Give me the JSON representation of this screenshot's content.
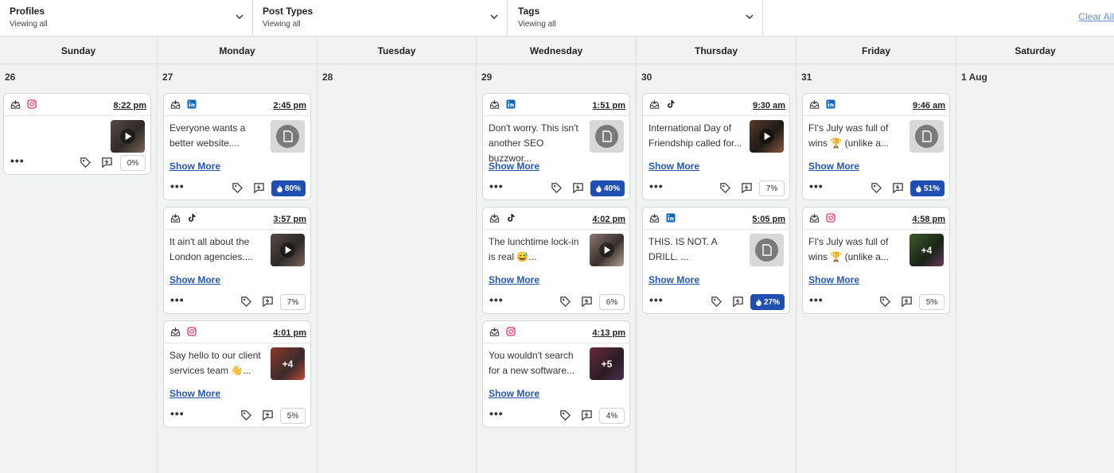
{
  "filters": [
    {
      "title": "Profiles",
      "subtitle": "Viewing all"
    },
    {
      "title": "Post Types",
      "subtitle": "Viewing all"
    },
    {
      "title": "Tags",
      "subtitle": "Viewing all"
    }
  ],
  "clear_all_label": "Clear All",
  "days": [
    {
      "name": "Sunday",
      "date": "26"
    },
    {
      "name": "Monday",
      "date": "27"
    },
    {
      "name": "Tuesday",
      "date": "28"
    },
    {
      "name": "Wednesday",
      "date": "29"
    },
    {
      "name": "Thursday",
      "date": "30"
    },
    {
      "name": "Friday",
      "date": "31"
    },
    {
      "name": "Saturday",
      "date": "1 Aug"
    }
  ],
  "show_more_label": "Show More",
  "colors": {
    "instagram": "#e1306c",
    "linkedin": "#0a66c2",
    "tiktok": "#111111",
    "score_hot": "#1f4fb3",
    "link": "#2456b4"
  },
  "posts": {
    "sun_1": {
      "network": "instagram-icon",
      "time": "8:22 pm",
      "text": "",
      "media": "video",
      "score": "0%"
    },
    "mon_1": {
      "network": "linkedin-icon",
      "time": "2:45 pm",
      "text": "Everyone wants a better website....",
      "media": "document",
      "score": "80%"
    },
    "mon_2": {
      "network": "tiktok-icon",
      "time": "3:57 pm",
      "text": "It ain't all about the London agencies....",
      "media": "video",
      "score": "7%"
    },
    "mon_3": {
      "network": "instagram-icon",
      "time": "4:01 pm",
      "text": "Say hello to our client services team 👋...",
      "media": "multi",
      "media_count": "+4",
      "score": "5%"
    },
    "wed_1": {
      "network": "linkedin-icon",
      "time": "1:51 pm",
      "text": "Don't worry. This isn't another SEO buzzwor...",
      "media": "document",
      "score": "40%"
    },
    "wed_2": {
      "network": "tiktok-icon",
      "time": "4:02 pm",
      "text": "The lunchtime lock-in is real 😅...",
      "media": "video",
      "score": "6%"
    },
    "wed_3": {
      "network": "instagram-icon",
      "time": "4:13 pm",
      "text": "You wouldn't search for a new software...",
      "media": "multi",
      "media_count": "+5",
      "score": "4%"
    },
    "thu_1": {
      "network": "tiktok-icon",
      "time": "9:30 am",
      "text": "International Day of Friendship called for...",
      "media": "video",
      "score": "7%"
    },
    "thu_2": {
      "network": "linkedin-icon",
      "time": "5:05 pm",
      "text": "THIS. IS NOT. A DRILL. ...",
      "media": "document",
      "score": "27%"
    },
    "fri_1": {
      "network": "linkedin-icon",
      "time": "9:46 am",
      "text": "FI's July was full of wins 🏆 (unlike a...",
      "media": "document",
      "score": "51%"
    },
    "fri_2": {
      "network": "instagram-icon",
      "time": "4:58 pm",
      "text": "FI's July was full of wins 🏆 (unlike a...",
      "media": "multi",
      "media_count": "+4",
      "score": "5%"
    }
  }
}
